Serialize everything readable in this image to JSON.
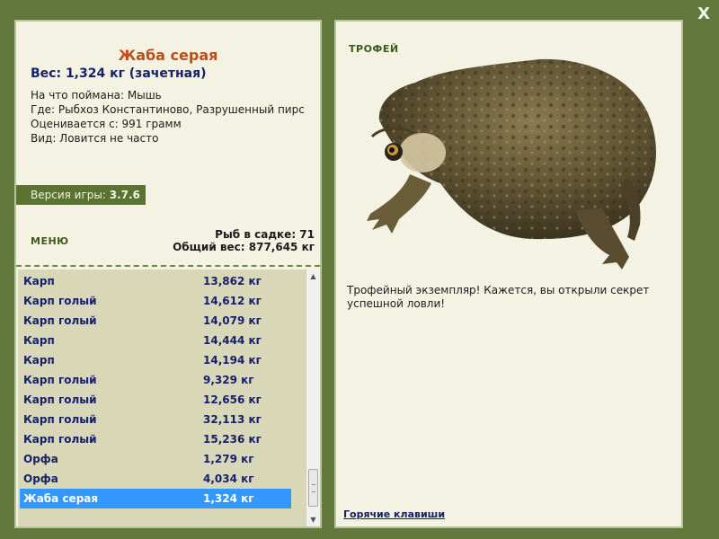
{
  "window": {
    "close_label": "X"
  },
  "fish": {
    "title": "Жаба серая",
    "weight": "Вес: 1,324 кг (зачетная)",
    "info": [
      "На что поймана: Мышь",
      "Где: Рыбхоз Константиново, Разрушенный пирс",
      "Оценивается с: 991 грамм",
      "Вид: Ловится не часто"
    ]
  },
  "version": {
    "label": "Версия игры:",
    "value": "3.7.6"
  },
  "menu_label": "МЕНЮ",
  "stats": {
    "fish_count": "Рыб в садке: 71",
    "total_weight": "Общий вес: 877,645 кг"
  },
  "catch_list": [
    {
      "name": "Карп",
      "weight": "13,862 кг"
    },
    {
      "name": "Карп голый",
      "weight": "14,612 кг"
    },
    {
      "name": "Карп голый",
      "weight": "14,079 кг"
    },
    {
      "name": "Карп",
      "weight": "14,444 кг"
    },
    {
      "name": "Карп",
      "weight": "14,194 кг"
    },
    {
      "name": "Карп голый",
      "weight": "9,329 кг"
    },
    {
      "name": "Карп голый",
      "weight": "12,656 кг"
    },
    {
      "name": "Карп голый",
      "weight": "32,113 кг"
    },
    {
      "name": "Карп голый",
      "weight": "15,236 кг"
    },
    {
      "name": "Орфа",
      "weight": "1,279 кг"
    },
    {
      "name": "Орфа",
      "weight": "4,034 кг"
    },
    {
      "name": "Жаба серая",
      "weight": "1,324 кг"
    }
  ],
  "selected_index": 11,
  "trophy": {
    "label": "ТРОФЕЙ",
    "text": "Трофейный экземпляр! Кажется, вы открыли секрет успешной ловли!"
  },
  "hotkeys_label": "Горячие клавиши",
  "icons": {
    "close": "close-icon",
    "scroll_up": "arrow-up-icon",
    "scroll_down": "arrow-down-icon"
  },
  "colors": {
    "background": "#62783c",
    "panel": "#f4f2e2",
    "title": "#c04e1a",
    "text_blue": "#16206b",
    "selection": "#3399ff",
    "list_bg": "#d8d7b8"
  }
}
